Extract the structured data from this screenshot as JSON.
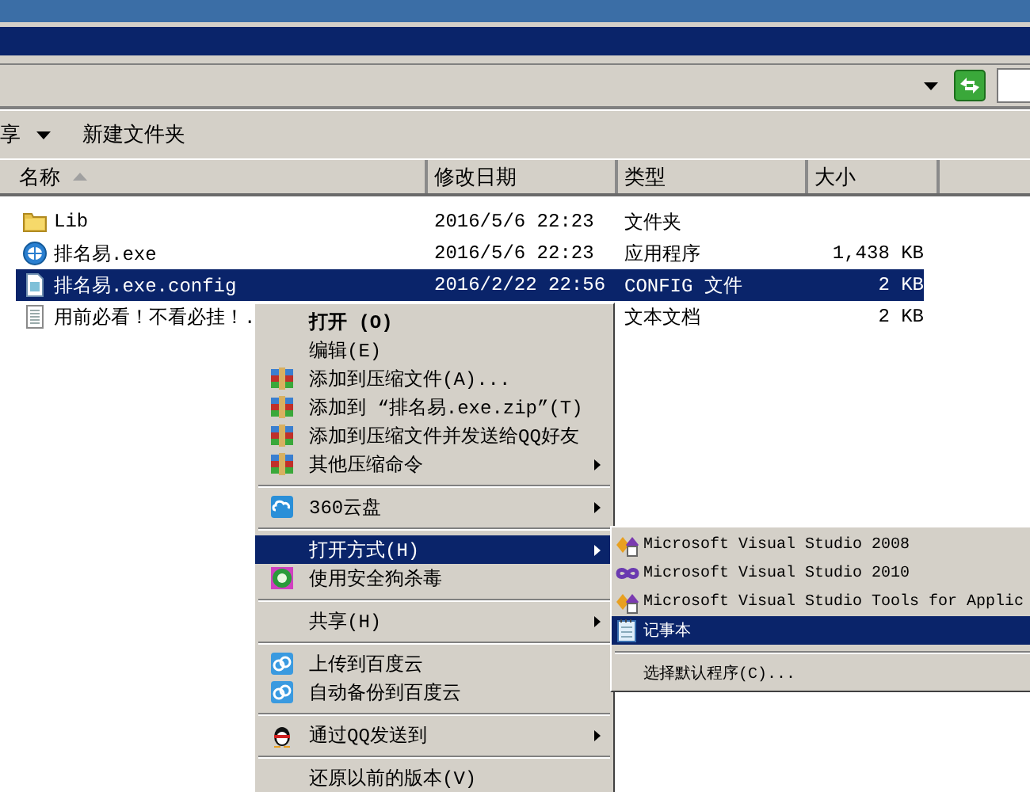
{
  "toolbar": {
    "buttons": [
      {
        "label": "享",
        "kind": "menu"
      },
      {
        "label": "新建文件夹",
        "kind": "plain"
      }
    ]
  },
  "columns": [
    {
      "label": "名称",
      "sorted": true
    },
    {
      "label": "修改日期",
      "sorted": false
    },
    {
      "label": "类型",
      "sorted": false
    },
    {
      "label": "大小",
      "sorted": false
    }
  ],
  "files": [
    {
      "name": "Lib",
      "modified": "2016/5/6 22:23",
      "type": "文件夹",
      "selected": false
    },
    {
      "name": "排名易.exe",
      "modified": "2016/5/6 22:23",
      "type": "应用程序",
      "size": "1,438 KB",
      "selected": false
    },
    {
      "name": "排名易.exe.config",
      "modified": "2016/2/22 22:56",
      "type": "CONFIG 文件",
      "size": "2 KB",
      "selected": true
    },
    {
      "name": "用前必看！不看必挂！.",
      "type": "文本文档",
      "size": "2 KB",
      "selected": false
    }
  ],
  "context_menu": {
    "items": [
      {
        "kind": "item",
        "label": "打开 (O)",
        "bold": true,
        "submenu": false,
        "selected": false
      },
      {
        "kind": "item",
        "label": "编辑(E)",
        "bold": false,
        "submenu": false,
        "selected": false
      },
      {
        "kind": "item",
        "label": "添加到压缩文件(A)...",
        "bold": false,
        "submenu": false,
        "selected": false
      },
      {
        "kind": "item",
        "label": "添加到 “排名易.exe.zip”(T)",
        "bold": false,
        "submenu": false,
        "selected": false
      },
      {
        "kind": "item",
        "label": "添加到压缩文件并发送给QQ好友",
        "bold": false,
        "submenu": false,
        "selected": false
      },
      {
        "kind": "item",
        "label": "其他压缩命令",
        "bold": false,
        "submenu": true,
        "selected": false
      },
      {
        "kind": "separator"
      },
      {
        "kind": "item",
        "label": "360云盘",
        "bold": false,
        "submenu": true,
        "selected": false
      },
      {
        "kind": "separator"
      },
      {
        "kind": "item",
        "label": "打开方式(H)",
        "bold": false,
        "submenu": true,
        "selected": true
      },
      {
        "kind": "item",
        "label": "使用安全狗杀毒",
        "bold": false,
        "submenu": false,
        "selected": false
      },
      {
        "kind": "separator"
      },
      {
        "kind": "item",
        "label": "共享(H)",
        "bold": false,
        "submenu": true,
        "selected": false
      },
      {
        "kind": "separator"
      },
      {
        "kind": "item",
        "label": "上传到百度云",
        "bold": false,
        "submenu": false,
        "selected": false
      },
      {
        "kind": "item",
        "label": "自动备份到百度云",
        "bold": false,
        "submenu": false,
        "selected": false
      },
      {
        "kind": "separator"
      },
      {
        "kind": "item",
        "label": "通过QQ发送到",
        "bold": false,
        "submenu": true,
        "selected": false
      },
      {
        "kind": "separator"
      },
      {
        "kind": "item",
        "label": "还原以前的版本(V)",
        "bold": false,
        "submenu": false,
        "selected": false
      }
    ]
  },
  "open_with_menu": {
    "items": [
      {
        "kind": "item",
        "label": "Microsoft Visual Studio 2008",
        "selected": false
      },
      {
        "kind": "item",
        "label": "Microsoft Visual Studio 2010",
        "selected": false
      },
      {
        "kind": "item",
        "label": "Microsoft Visual Studio Tools for Applic",
        "selected": false
      },
      {
        "kind": "item",
        "label": "记事本",
        "selected": true
      },
      {
        "kind": "separator"
      },
      {
        "kind": "item",
        "label": "选择默认程序(C)...",
        "selected": false
      }
    ]
  }
}
